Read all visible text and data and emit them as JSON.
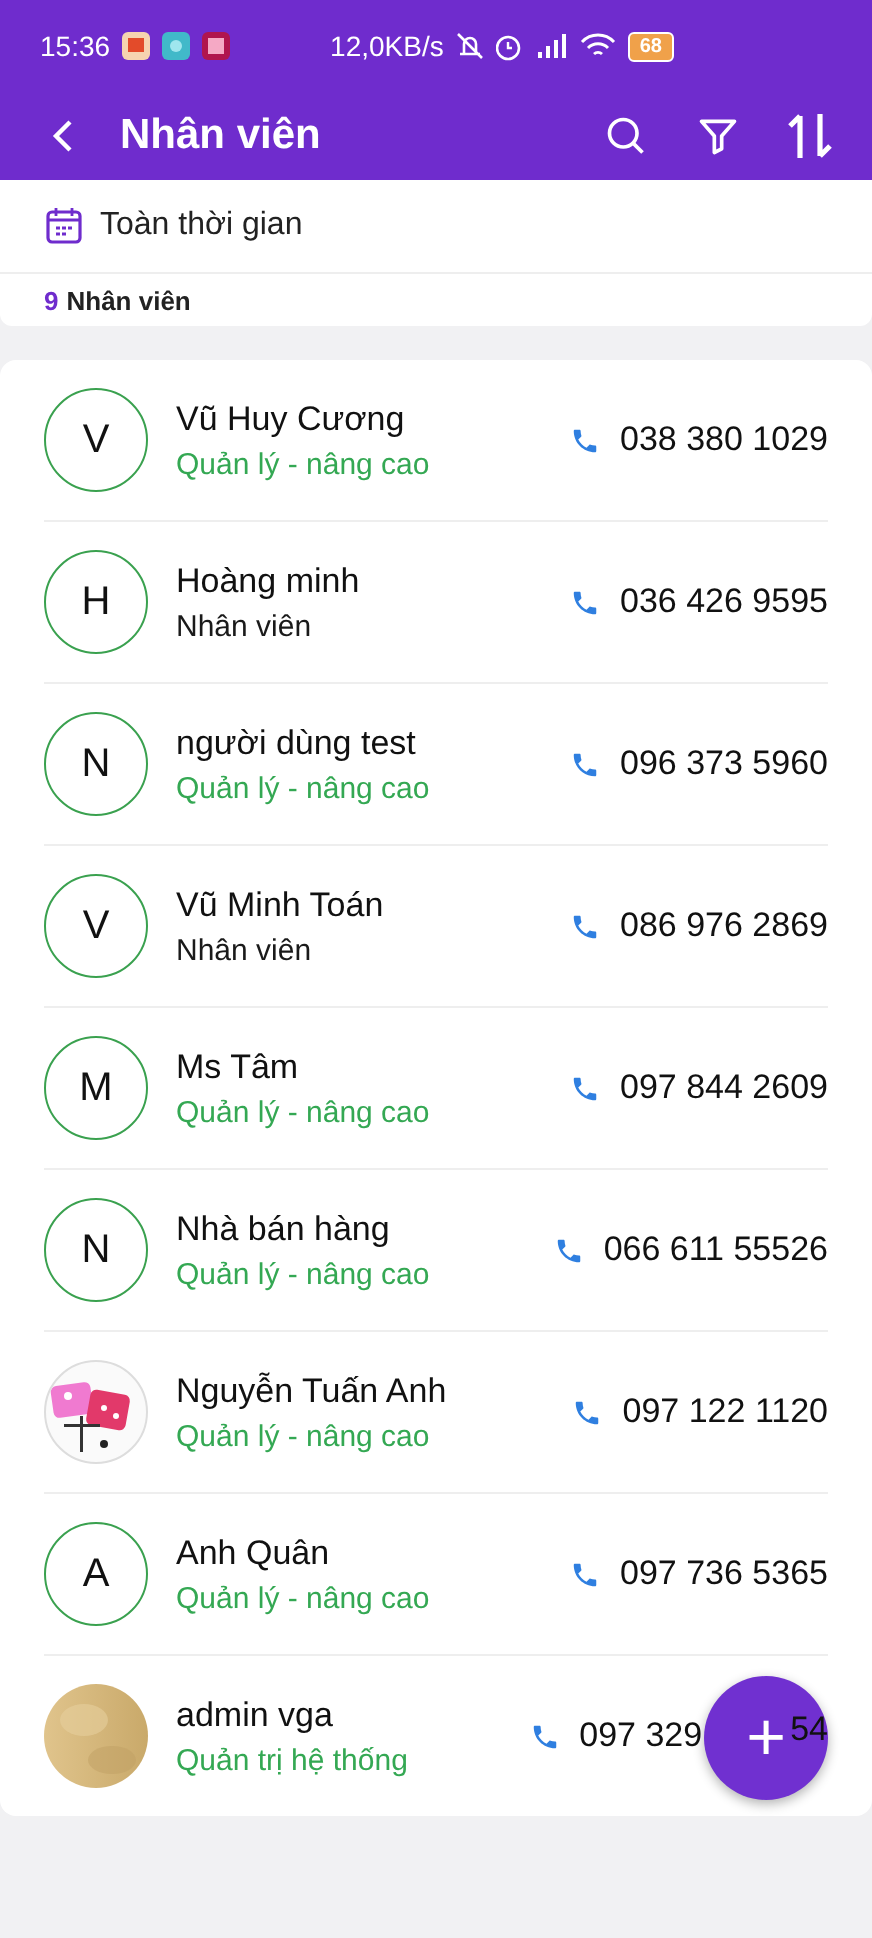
{
  "status_bar": {
    "time": "15:36",
    "speed": "12,0KB/s",
    "battery": "68"
  },
  "header": {
    "title": "Nhân viên"
  },
  "filter": {
    "label": "Toàn thời gian"
  },
  "summary": {
    "count": "9",
    "label": "Nhân viên"
  },
  "employees": [
    {
      "avatar": {
        "kind": "initial",
        "letter": "V"
      },
      "name": "Vũ Huy Cương",
      "role": "Quản lý - nâng cao",
      "color": "#34a853",
      "phone": "038 380 1029"
    },
    {
      "avatar": {
        "kind": "initial",
        "letter": "H"
      },
      "name": "Hoàng minh",
      "role": "Nhân viên",
      "color": "#1a1a1a",
      "phone": "036 426 9595"
    },
    {
      "avatar": {
        "kind": "initial",
        "letter": "N"
      },
      "name": "người dùng test",
      "role": "Quản lý - nâng cao",
      "color": "#34a853",
      "phone": "096 373 5960"
    },
    {
      "avatar": {
        "kind": "initial",
        "letter": "V"
      },
      "name": "Vũ Minh Toán",
      "role": "Nhân viên",
      "color": "#1a1a1a",
      "phone": "086 976 2869"
    },
    {
      "avatar": {
        "kind": "initial",
        "letter": "M"
      },
      "name": "Ms Tâm",
      "role": "Quản lý - nâng cao",
      "color": "#34a853",
      "phone": "097 844 2609"
    },
    {
      "avatar": {
        "kind": "initial",
        "letter": "N"
      },
      "name": "Nhà bán hàng",
      "role": "Quản lý - nâng cao",
      "color": "#34a853",
      "phone": "066 611 55526"
    },
    {
      "name": "Nguyễn Tuấn Anh",
      "role": "Quản lý - nâng cao",
      "color": "#34a853",
      "phone": "097 122 1120"
    },
    {
      "avatar": {
        "kind": "initial",
        "letter": "A"
      },
      "name": "Anh Quân",
      "role": "Quản lý - nâng cao",
      "color": "#34a853",
      "phone": "097 736 5365"
    },
    {
      "avatar": {
        "kind": "photo_plain"
      },
      "name": "admin vga",
      "role": "Quản trị hệ thống",
      "color": "#34a853",
      "phone": "097 329",
      "phone_tail": "54"
    }
  ],
  "fab": {
    "label": "+"
  }
}
